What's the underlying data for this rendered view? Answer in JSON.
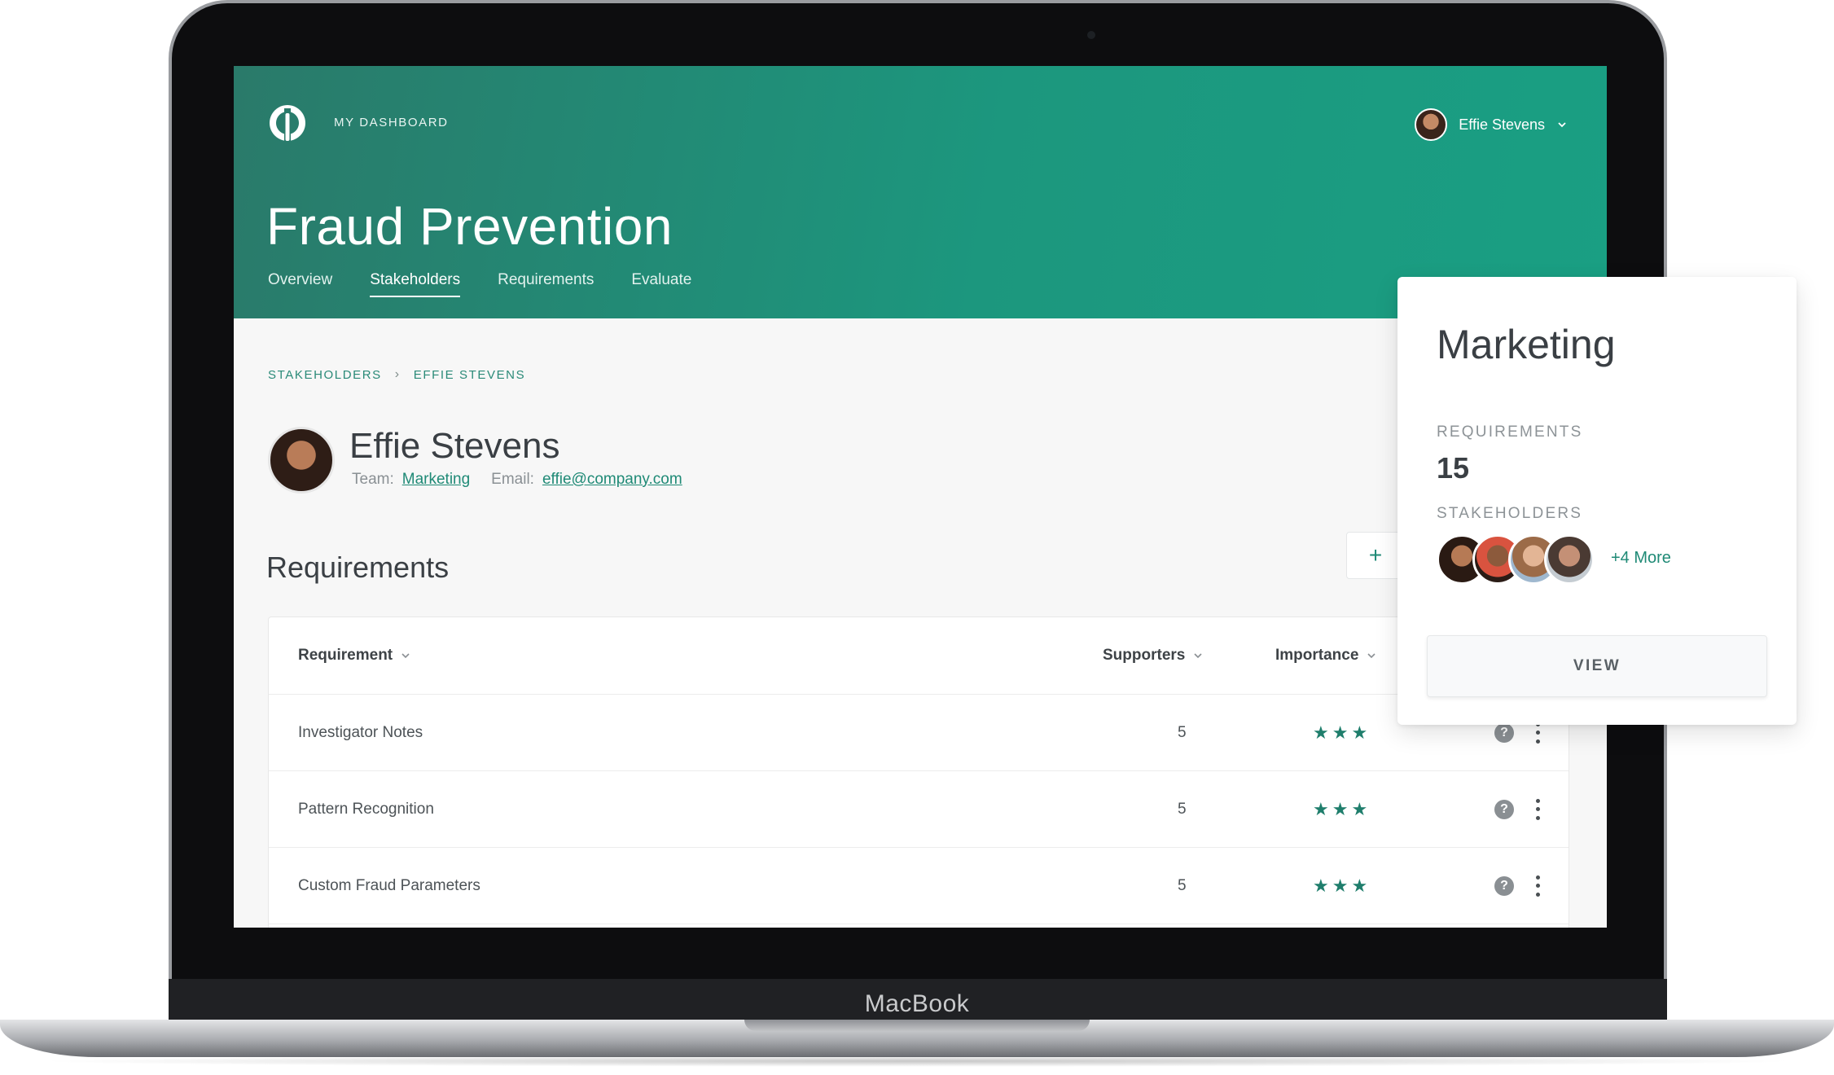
{
  "device": {
    "brand": "MacBook"
  },
  "header": {
    "dashboard_label": "MY DASHBOARD",
    "user_name": "Effie Stevens",
    "title": "Fraud Prevention",
    "tabs": [
      {
        "label": "Overview"
      },
      {
        "label": "Stakeholders",
        "active": true
      },
      {
        "label": "Requirements"
      },
      {
        "label": "Evaluate"
      }
    ]
  },
  "breadcrumb": {
    "parent": "STAKEHOLDERS",
    "separator": "›",
    "current": "EFFIE STEVENS"
  },
  "profile": {
    "name": "Effie Stevens",
    "team_label": "Team:",
    "team": "Marketing",
    "email_label": "Email:",
    "email": "effie@company.com"
  },
  "requirements": {
    "heading": "Requirements",
    "add_label": "+",
    "columns": {
      "requirement": "Requirement",
      "supporters": "Supporters",
      "importance": "Importance"
    },
    "rows": [
      {
        "name": "Investigator Notes",
        "supporters": "5",
        "importance": "★★★",
        "help": "?"
      },
      {
        "name": "Pattern Recognition",
        "supporters": "5",
        "importance": "★★★",
        "help": "?"
      },
      {
        "name": "Custom Fraud Parameters",
        "supporters": "5",
        "importance": "★★★",
        "help": "?"
      }
    ]
  },
  "card": {
    "title": "Marketing",
    "requirements_label": "REQUIREMENTS",
    "requirements_count": "15",
    "stakeholders_label": "STAKEHOLDERS",
    "more_label": "+4 More",
    "view_label": "VIEW"
  },
  "colors": {
    "accent": "#1f8a76",
    "hero_start": "#2a7a6a",
    "hero_end": "#1a9f83"
  }
}
